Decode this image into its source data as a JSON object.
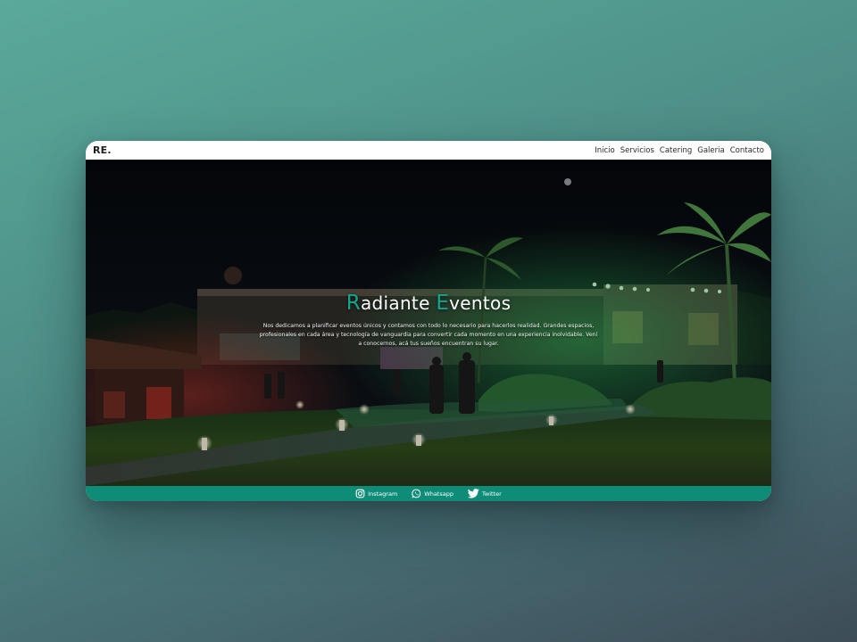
{
  "nav": {
    "logo": "RE.",
    "links": [
      "Inicio",
      "Servicios",
      "Catering",
      "Galeria",
      "Contacto"
    ]
  },
  "hero": {
    "title_first_initial": "R",
    "title_first_rest": "adiante ",
    "title_second_initial": "E",
    "title_second_rest": "ventos",
    "description": "Nos dedicamos a planificar eventos únicos y contamos con todo lo necesario para hacerlos realidad. Grandes espacios, profesionales en cada área y tecnología de vanguardia para convertir cada momento en una experiencia inolvidable. Vení a conocernos, acá tus sueños encuentran su lugar."
  },
  "footer": {
    "socials": [
      {
        "label": "Instagram",
        "icon": "instagram-icon"
      },
      {
        "label": "Whatsapp",
        "icon": "whatsapp-icon"
      },
      {
        "label": "Twitter",
        "icon": "twitter-icon"
      }
    ]
  },
  "colors": {
    "accent": "#13a58c",
    "footer_bg": "#0e8c78",
    "navbar_bg": "#ffffff",
    "page_bg_start": "#5aa99a",
    "page_bg_end": "#3e4c57"
  }
}
